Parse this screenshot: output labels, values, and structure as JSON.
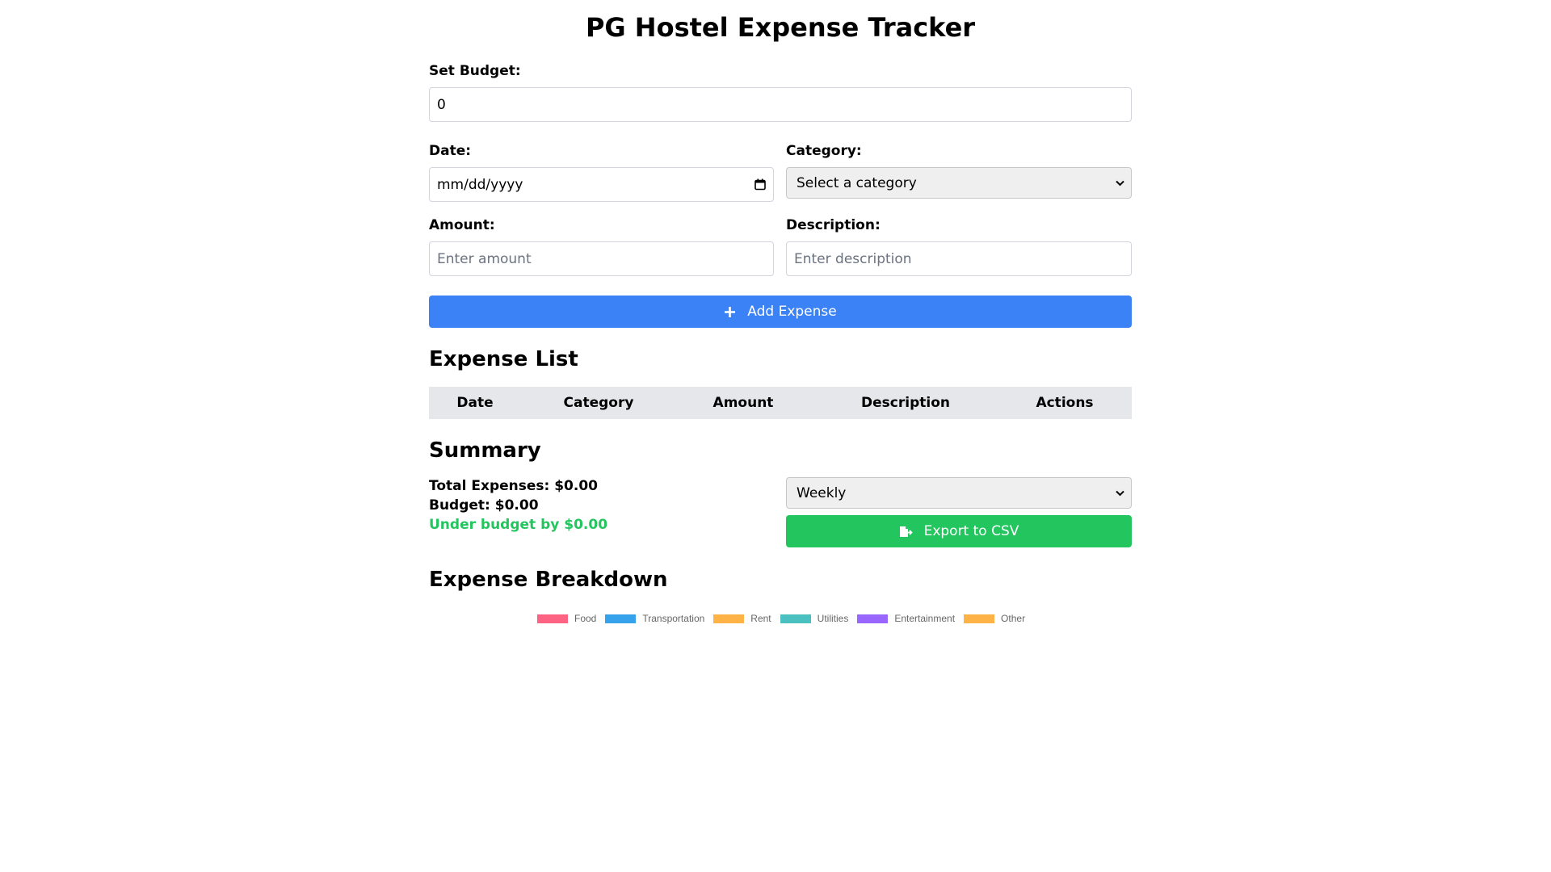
{
  "app": {
    "title": "PG Hostel Expense Tracker"
  },
  "budget": {
    "label": "Set Budget:",
    "value": "0"
  },
  "form": {
    "date_label": "Date:",
    "date_placeholder": "mm/dd/yyyy",
    "category_label": "Category:",
    "category_selected": "Select a category",
    "amount_label": "Amount:",
    "amount_placeholder": "Enter amount",
    "description_label": "Description:",
    "description_placeholder": "Enter description",
    "add_button": "Add Expense"
  },
  "expense_list": {
    "title": "Expense List",
    "columns": [
      "Date",
      "Category",
      "Amount",
      "Description",
      "Actions"
    ],
    "rows": []
  },
  "summary": {
    "title": "Summary",
    "total": "Total Expenses: $0.00",
    "budget": "Budget: $0.00",
    "status": "Under budget by $0.00",
    "status_color": "#22c55e",
    "period_selected": "Weekly",
    "export_button": "Export to CSV"
  },
  "breakdown": {
    "title": "Expense Breakdown",
    "legend": [
      {
        "label": "Food",
        "color": "#ff6384"
      },
      {
        "label": "Transportation",
        "color": "#36a2eb"
      },
      {
        "label": "Rent",
        "color": "#ffb347"
      },
      {
        "label": "Utilities",
        "color": "#4bc0c0"
      },
      {
        "label": "Entertainment",
        "color": "#9966ff"
      },
      {
        "label": "Other",
        "color": "#ffb347"
      }
    ]
  },
  "colors": {
    "primary": "#3b82f6",
    "success": "#22c55e",
    "table_header_bg": "#e5e7eb"
  }
}
